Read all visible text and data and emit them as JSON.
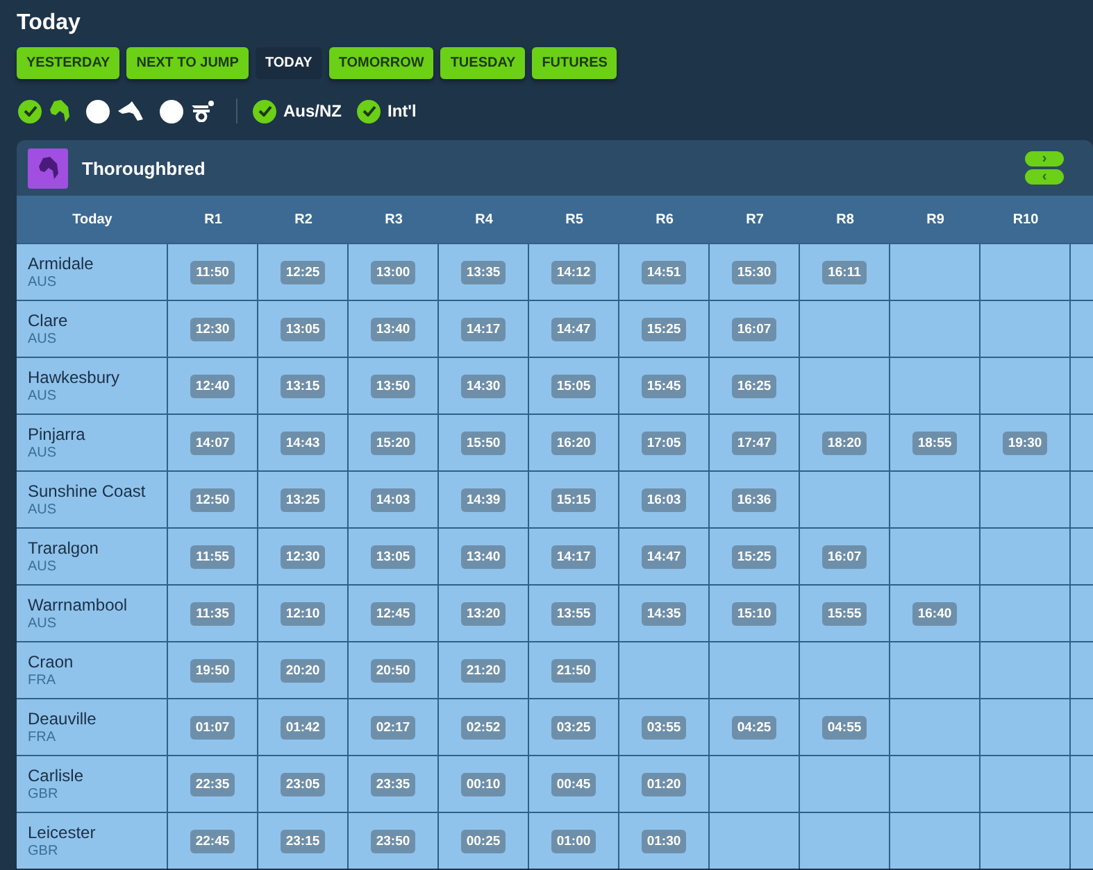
{
  "page_title": "Today",
  "day_tabs": [
    {
      "label": "YESTERDAY",
      "selected": false
    },
    {
      "label": "NEXT TO JUMP",
      "selected": false
    },
    {
      "label": "TODAY",
      "selected": true
    },
    {
      "label": "TOMORROW",
      "selected": false
    },
    {
      "label": "TUESDAY",
      "selected": false
    },
    {
      "label": "FUTURES",
      "selected": false
    }
  ],
  "code_filters": [
    {
      "kind": "thoroughbred",
      "checked": true
    },
    {
      "kind": "greyhound",
      "checked": false
    },
    {
      "kind": "harness",
      "checked": false
    }
  ],
  "region_filters": [
    {
      "label": "Aus/NZ",
      "checked": true
    },
    {
      "label": "Int'l",
      "checked": true
    }
  ],
  "panel": {
    "kind": "thoroughbred",
    "title": "Thoroughbred",
    "scroll_buttons": [
      "›",
      "‹"
    ],
    "columns": [
      "Today",
      "R1",
      "R2",
      "R3",
      "R4",
      "R5",
      "R6",
      "R7",
      "R8",
      "R9",
      "R10"
    ],
    "rows": [
      {
        "venue": "Armidale",
        "country": "AUS",
        "times": [
          "11:50",
          "12:25",
          "13:00",
          "13:35",
          "14:12",
          "14:51",
          "15:30",
          "16:11"
        ]
      },
      {
        "venue": "Clare",
        "country": "AUS",
        "times": [
          "12:30",
          "13:05",
          "13:40",
          "14:17",
          "14:47",
          "15:25",
          "16:07"
        ]
      },
      {
        "venue": "Hawkesbury",
        "country": "AUS",
        "times": [
          "12:40",
          "13:15",
          "13:50",
          "14:30",
          "15:05",
          "15:45",
          "16:25"
        ]
      },
      {
        "venue": "Pinjarra",
        "country": "AUS",
        "times": [
          "14:07",
          "14:43",
          "15:20",
          "15:50",
          "16:20",
          "17:05",
          "17:47",
          "18:20",
          "18:55",
          "19:30"
        ]
      },
      {
        "venue": "Sunshine Coast",
        "country": "AUS",
        "times": [
          "12:50",
          "13:25",
          "14:03",
          "14:39",
          "15:15",
          "16:03",
          "16:36"
        ]
      },
      {
        "venue": "Traralgon",
        "country": "AUS",
        "times": [
          "11:55",
          "12:30",
          "13:05",
          "13:40",
          "14:17",
          "14:47",
          "15:25",
          "16:07"
        ]
      },
      {
        "venue": "Warrnambool",
        "country": "AUS",
        "times": [
          "11:35",
          "12:10",
          "12:45",
          "13:20",
          "13:55",
          "14:35",
          "15:10",
          "15:55",
          "16:40"
        ]
      },
      {
        "venue": "Craon",
        "country": "FRA",
        "times": [
          "19:50",
          "20:20",
          "20:50",
          "21:20",
          "21:50"
        ]
      },
      {
        "venue": "Deauville",
        "country": "FRA",
        "times": [
          "01:07",
          "01:42",
          "02:17",
          "02:52",
          "03:25",
          "03:55",
          "04:25",
          "04:55"
        ]
      },
      {
        "venue": "Carlisle",
        "country": "GBR",
        "times": [
          "22:35",
          "23:05",
          "23:35",
          "00:10",
          "00:45",
          "01:20"
        ]
      },
      {
        "venue": "Leicester",
        "country": "GBR",
        "times": [
          "22:45",
          "23:15",
          "23:50",
          "00:25",
          "01:00",
          "01:30"
        ]
      }
    ]
  }
}
